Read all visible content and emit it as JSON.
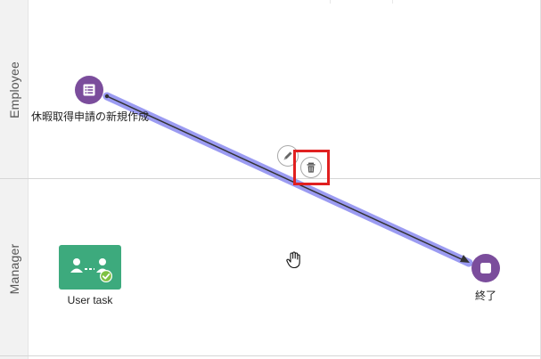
{
  "lanes": {
    "employee": {
      "label": "Employee"
    },
    "manager": {
      "label": "Manager"
    }
  },
  "nodes": {
    "start": {
      "label": "休暇取得申請の新規作成",
      "icon": "list-icon",
      "color": "#7b4d9c"
    },
    "end": {
      "label": "終了",
      "icon": "stop-icon",
      "color": "#7b4d9c"
    },
    "user_task": {
      "label": "User task",
      "icon": "users-check-icon",
      "color": "#3daa7d"
    }
  },
  "connection": {
    "selected": true,
    "highlight_color": "#9b9bf2",
    "line_color": "#333333"
  },
  "toolbar": {
    "edit_icon": "pencil-icon",
    "delete_icon": "trash-icon",
    "highlight_color": "#e02020"
  }
}
